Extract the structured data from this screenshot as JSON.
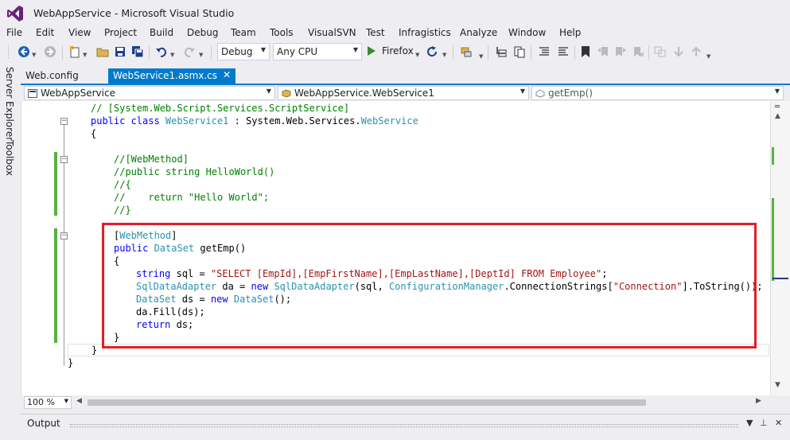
{
  "window": {
    "title": "WebAppService - Microsoft Visual Studio"
  },
  "menu": [
    "File",
    "Edit",
    "View",
    "Project",
    "Build",
    "Debug",
    "Team",
    "Tools",
    "VisualSVN",
    "Test",
    "Infragistics",
    "Analyze",
    "Window",
    "Help"
  ],
  "toolbar": {
    "config": "Debug",
    "platform": "Any CPU",
    "run_label": "Firefox"
  },
  "side_tabs": [
    "Server Explorer",
    "Toolbox"
  ],
  "doc_tabs": [
    {
      "label": "Web.config",
      "active": false
    },
    {
      "label": "WebService1.asmx.cs",
      "active": true
    }
  ],
  "navbar": {
    "project": "WebAppService",
    "type": "WebAppService.WebService1",
    "member": "getEmp()"
  },
  "code": {
    "l1": "// [System.Web.Script.Services.ScriptService]",
    "l2_kw": "public class ",
    "l2_cls": "WebService1",
    "l2_mid": " : System.Web.Services.",
    "l2_base": "WebService",
    "l3": "{",
    "l4": "//[WebMethod]",
    "l5": "//public string HelloWorld()",
    "l6": "//{",
    "l7": "//    return \"Hello World\";",
    "l8": "//}",
    "l9_open": "[",
    "l9_attr": "WebMethod",
    "l9_close": "]",
    "l10_kw": "public ",
    "l10_ty": "DataSet",
    "l10_rest": " getEmp()",
    "l11": "{",
    "l12_kw": "string",
    "l12_mid": " sql = ",
    "l12_str": "\"SELECT [EmpId],[EmpFirstName],[EmpLastName],[DeptId] FROM Employee\"",
    "l12_end": ";",
    "l13_ty1": "SqlDataAdapter",
    "l13_a": " da = ",
    "l13_new": "new",
    "l13_sp": " ",
    "l13_ty2": "SqlDataAdapter",
    "l13_b": "(sql, ",
    "l13_ty3": "ConfigurationManager",
    "l13_c": ".ConnectionStrings[",
    "l13_str": "\"Connection\"",
    "l13_d": "].ToString());",
    "l14_ty": "DataSet",
    "l14_a": " ds = ",
    "l14_new": "new",
    "l14_sp": " ",
    "l14_ty2": "DataSet",
    "l14_b": "();",
    "l15": "da.Fill(ds);",
    "l16_kw": "return",
    "l16_rest": " ds;",
    "l17": "}",
    "l18": "}",
    "l19": "}"
  },
  "zoom": "100 %",
  "output": {
    "title": "Output"
  },
  "colors": {
    "accent": "#007acc",
    "highlight_box": "#e21e26",
    "vs_purple": "#68217a"
  }
}
